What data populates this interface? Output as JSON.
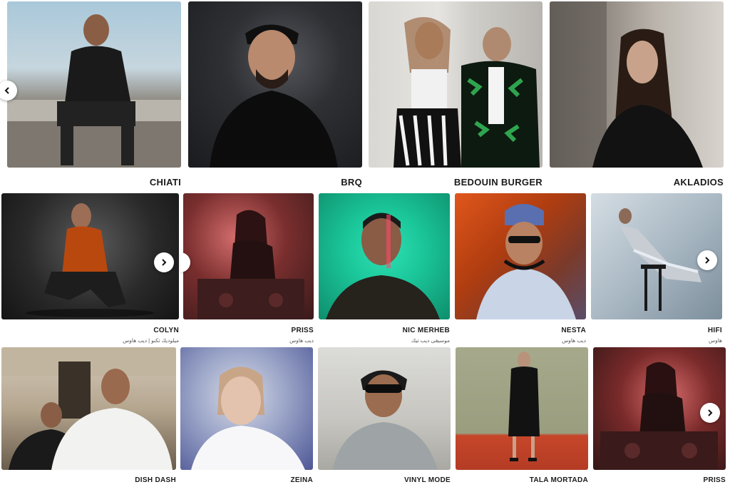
{
  "rows": [
    {
      "artists": [
        {
          "name": "CHIATI",
          "genre": ""
        },
        {
          "name": "BRQ",
          "genre": ""
        },
        {
          "name": "BEDOUIN BURGER",
          "genre": ""
        },
        {
          "name": "AKLADIOS",
          "genre": ""
        }
      ]
    },
    {
      "artists": [
        {
          "name": "COLYN",
          "genre": "ميلوديك تكنو | ديب هاوس"
        },
        {
          "name": "PRISS",
          "genre": "ديب هاوس"
        },
        {
          "name": "NIC MERHEB",
          "genre": "موسيقى ديب تيك"
        },
        {
          "name": "NESTA",
          "genre": "ديب هاوس"
        },
        {
          "name": "HIFI",
          "genre": "هاوس"
        }
      ]
    },
    {
      "artists": [
        {
          "name": "DISH DASH",
          "genre": ""
        },
        {
          "name": "ZEINA",
          "genre": ""
        },
        {
          "name": "VINYL MODE",
          "genre": ""
        },
        {
          "name": "TALA MORTADA",
          "genre": ""
        },
        {
          "name": "PRISS",
          "genre": ""
        }
      ]
    }
  ],
  "icons": {
    "prev": "chevron-left-icon",
    "next": "chevron-right-icon"
  },
  "colors": {
    "text": "#1b1b1b",
    "genre": "#555555",
    "background": "#ffffff"
  }
}
